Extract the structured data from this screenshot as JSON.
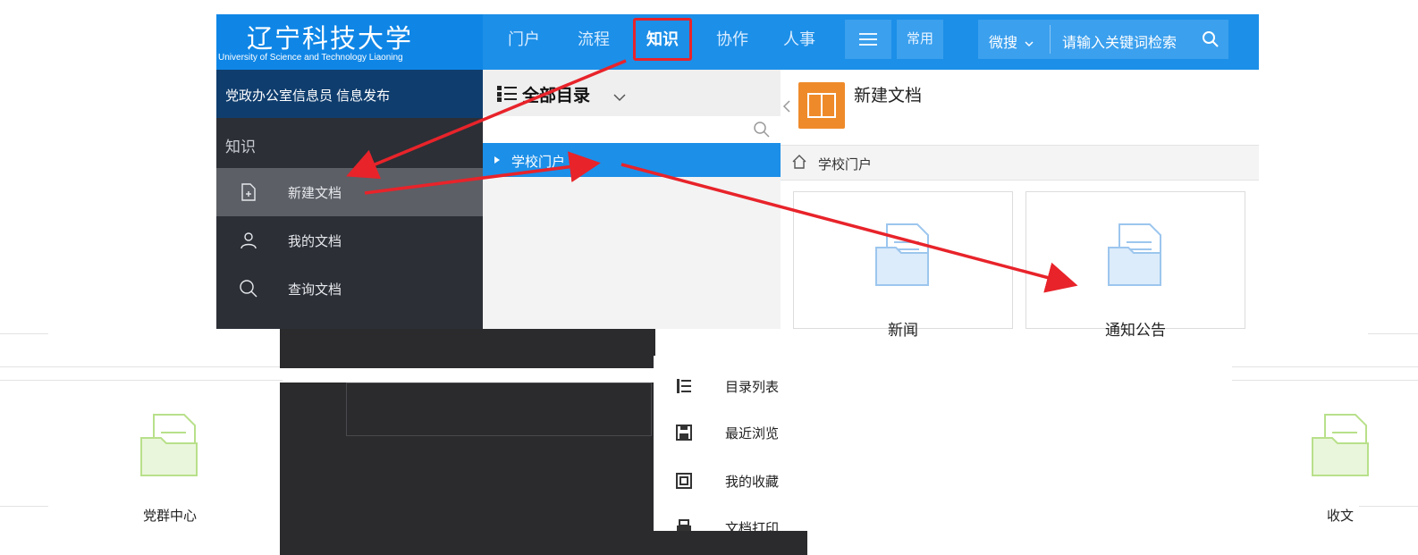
{
  "header": {
    "logo_cn": "辽宁科技大学",
    "logo_en": "University of Science and Technology Liaoning",
    "nav": [
      "门户",
      "流程",
      "知识",
      "协作",
      "人事"
    ],
    "active_nav": "知识",
    "common_label": "常用",
    "search_scope": "微搜",
    "search_placeholder": "请输入关键词检索"
  },
  "sidebar": {
    "user_text": "党政办公室信息员 信息发布",
    "section_label": "知识",
    "items": [
      {
        "label": "新建文档",
        "icon": "new-doc-icon",
        "active": true
      },
      {
        "label": "我的文档",
        "icon": "user-icon",
        "active": false
      },
      {
        "label": "查询文档",
        "icon": "search-icon",
        "active": false
      }
    ]
  },
  "catalog": {
    "title": "全部目录",
    "tree_item": "学校门户"
  },
  "content": {
    "title": "新建文档",
    "breadcrumb": "学校门户",
    "cards": [
      "新闻",
      "通知公告"
    ]
  },
  "lower": {
    "left_card": "党群中心",
    "right_card": "收文",
    "menu_items": [
      "目录列表",
      "最近浏览",
      "我的收藏",
      "文档打印"
    ]
  },
  "colors": {
    "header_blue": "#1c8fe8",
    "sidebar_dark": "#2c2f36",
    "annotation_red": "#e8232a",
    "accent_orange": "#ef8a2a"
  }
}
